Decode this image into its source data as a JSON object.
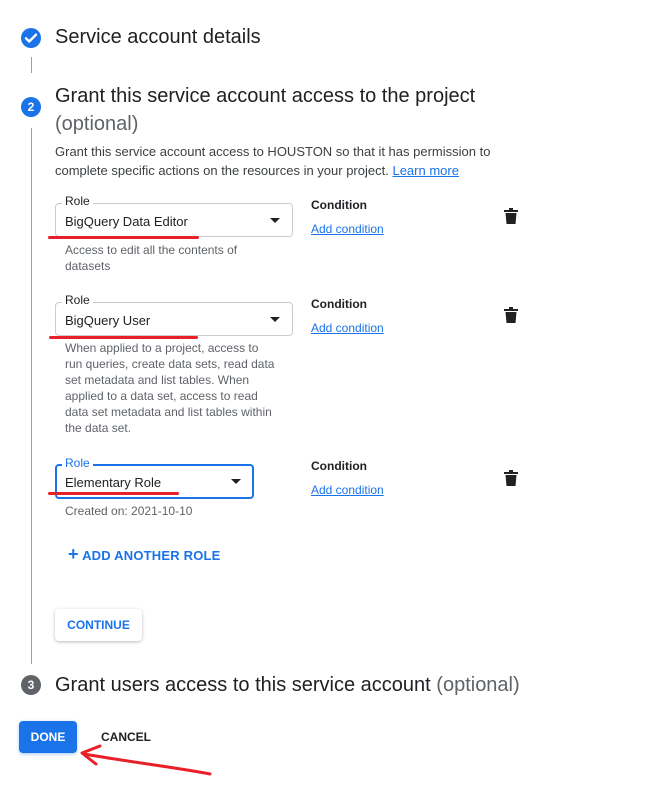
{
  "steps": [
    {
      "number": "✓",
      "title": "Service account details"
    },
    {
      "number": "2",
      "title": "Grant this service account access to the project",
      "optional": "(optional)",
      "description": "Grant this service account access to HOUSTON so that it has permission to complete specific actions on the resources in your project.",
      "learn_more": "Learn more"
    },
    {
      "number": "3",
      "title": "Grant users access to this service account",
      "optional": "(optional)"
    }
  ],
  "roles": [
    {
      "label": "Role",
      "value": "BigQuery Data Editor",
      "hint": [
        "Access to edit all the contents of",
        "datasets"
      ],
      "condition_label": "Condition",
      "condition_link": "Add condition"
    },
    {
      "label": "Role",
      "value": "BigQuery User",
      "hint": [
        "When applied to a project, access to",
        "run queries, create data sets, read data",
        "set metadata and list tables. When",
        "applied to a data set, access to read",
        "data set metadata and list tables within",
        "the data set."
      ],
      "condition_label": "Condition",
      "condition_link": "Add condition"
    },
    {
      "label": "Role",
      "value": "Elementary Role",
      "hint": [
        "Created on: 2021-10-10"
      ],
      "condition_label": "Condition",
      "condition_link": "Add condition"
    }
  ],
  "add_role": {
    "icon": "+",
    "label": "ADD ANOTHER ROLE"
  },
  "buttons": {
    "continue": "CONTINUE",
    "done": "DONE",
    "cancel": "CANCEL"
  },
  "annotations": {
    "color": "#e8202a"
  },
  "colors": {
    "accent": "#1a73e8",
    "muted": "#5f6368"
  }
}
